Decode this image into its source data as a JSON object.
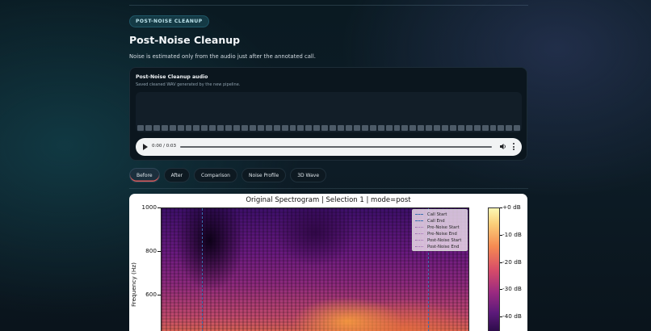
{
  "section": {
    "badge": "POST-NOISE CLEANUP",
    "title": "Post-Noise Cleanup",
    "subtitle": "Noise is estimated only from the audio just after the annotated call."
  },
  "audio": {
    "title": "Post-Noise Cleanup audio",
    "description": "Saved cleaned WAV generated by the new pipeline.",
    "time": "0:00 / 0:03"
  },
  "tabs": [
    {
      "label": "Before",
      "active": true
    },
    {
      "label": "After"
    },
    {
      "label": "Comparison"
    },
    {
      "label": "Noise Profile"
    },
    {
      "label": "3D Wave"
    }
  ],
  "chart_data": {
    "type": "heatmap",
    "title": "Original Spectrogram | Selection 1 | mode=post",
    "ylabel": "Frequency (Hz)",
    "y_ticks": [
      "1000",
      "800",
      "600"
    ],
    "colorbar_ticks": [
      "+0 dB",
      "-10 dB",
      "-20 dB",
      "-30 dB",
      "-40 dB"
    ],
    "legend": [
      {
        "label": "Call Start",
        "style": "dashed",
        "color": "#3a6fb0"
      },
      {
        "label": "Call End",
        "style": "dashed",
        "color": "#3a6fb0"
      },
      {
        "label": "Pre-Noise Start",
        "style": "dotted",
        "color": "#9c6bb0"
      },
      {
        "label": "Pre-Noise End",
        "style": "dotted",
        "color": "#9c6bb0"
      },
      {
        "label": "Post-Noise Start",
        "style": "dotted",
        "color": "#9c6bb0"
      },
      {
        "label": "Post-Noise End",
        "style": "dotted",
        "color": "#9c6bb0"
      }
    ]
  }
}
